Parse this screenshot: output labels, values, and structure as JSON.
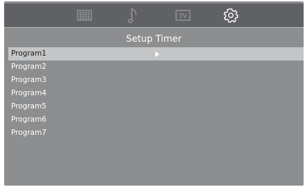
{
  "topbar": {
    "tabs": [
      {
        "icon": "picture-grid-icon",
        "active": false
      },
      {
        "icon": "music-note-icon",
        "active": false
      },
      {
        "icon": "tv-icon",
        "label": "TV",
        "active": false
      },
      {
        "icon": "gear-icon",
        "active": true
      }
    ]
  },
  "menu": {
    "title": "Setup Timer",
    "items": [
      {
        "label": "Program1",
        "selected": true
      },
      {
        "label": "Program2"
      },
      {
        "label": "Program3"
      },
      {
        "label": "Program4"
      },
      {
        "label": "Program5"
      },
      {
        "label": "Program6"
      },
      {
        "label": "Program7"
      }
    ]
  },
  "colors": {
    "panel_bg": "#8d8e90",
    "topbar_bg": "#606164",
    "selected_row_bg": "#c4c5c7",
    "text": "#ffffff"
  }
}
